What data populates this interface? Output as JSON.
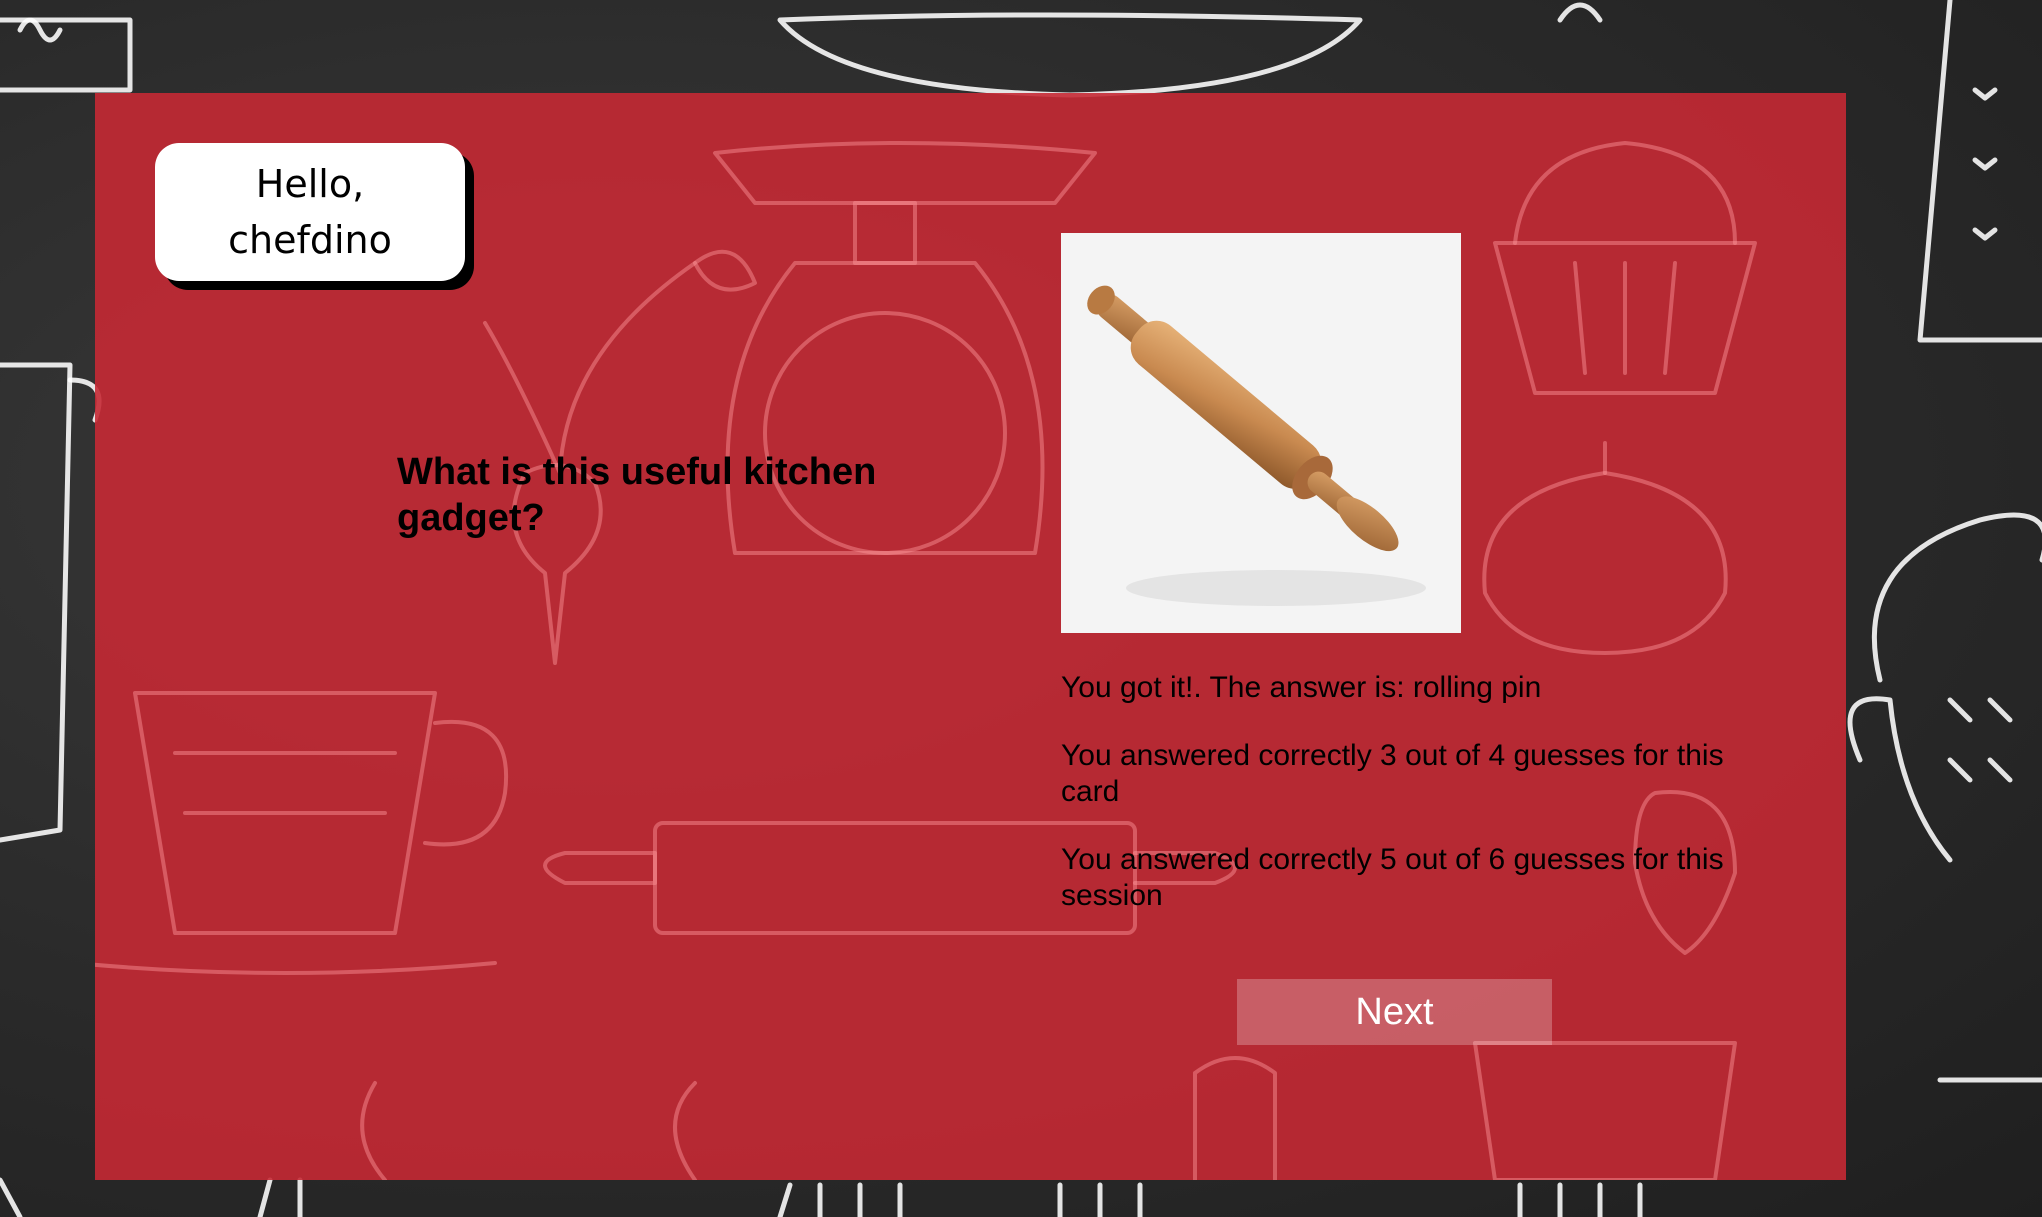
{
  "greeting": {
    "line1": "Hello,",
    "line2": "chefdino"
  },
  "quiz": {
    "question": "What is this useful kitchen gadget?",
    "image_icon": "rolling-pin-photo"
  },
  "results": {
    "answer_line": "You got it!. The answer is: rolling pin",
    "card_score": "You answered correctly 3 out of 4 guesses for this card",
    "session_score": "You answered correctly 5 out of 6 guesses for this session"
  },
  "actions": {
    "next_label": "Next"
  },
  "colors": {
    "card_background": "#c52934",
    "page_background": "#2b2b2b",
    "button_fill": "rgba(255,255,255,0.25)"
  }
}
